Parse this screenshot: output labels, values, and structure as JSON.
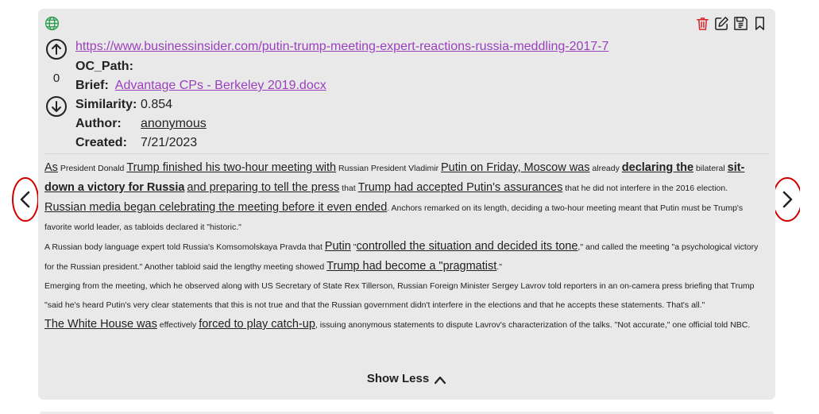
{
  "card": {
    "url": "https://www.businessinsider.com/putin-trump-meeting-expert-reactions-russia-meddling-2017-7",
    "vote_count": "0",
    "oc_path_label": "OC_Path:",
    "brief_label": "Brief:",
    "brief_link": "Advantage CPs - Berkeley 2019.docx",
    "similarity_label": "Similarity:",
    "similarity_value": "0.854",
    "author_label": "Author:",
    "author_value": "anonymous",
    "created_label": "Created:",
    "created_value": "7/21/2023",
    "show_less_label": "Show Less"
  },
  "icons": {
    "globe": "globe-icon",
    "delete": "trash-icon",
    "edit": "edit-icon",
    "save": "save-icon",
    "bookmark": "bookmark-icon",
    "upvote": "arrow-up-circle-icon",
    "downvote": "arrow-down-circle-icon",
    "prev": "chevron-left-icon",
    "next": "chevron-right-icon"
  },
  "colors": {
    "link": "#9b3fbf",
    "delete": "#d62828",
    "globe": "#2e9e4f",
    "nav_ring": "#d10000",
    "card_bg": "#e9e9e9"
  },
  "body": {
    "p1": [
      {
        "t": "As",
        "s": "hl"
      },
      {
        "t": " President Donald ",
        "s": "sm"
      },
      {
        "t": "Trump finished his two-hour meeting with",
        "s": "hl"
      },
      {
        "t": " Russian President Vladimir ",
        "s": "sm"
      },
      {
        "t": "Putin on Friday, Moscow was",
        "s": "hl"
      },
      {
        "t": " already ",
        "s": "sm"
      },
      {
        "t": "declaring the",
        "s": "hlb"
      },
      {
        "t": " bilateral ",
        "s": "sm"
      },
      {
        "t": "sit-down a victory for Russia",
        "s": "hlb"
      },
      {
        "t": " ",
        "s": "sm"
      },
      {
        "t": "and preparing to tell the press",
        "s": "hl"
      },
      {
        "t": " that ",
        "s": "sm"
      },
      {
        "t": "Trump had accepted Putin's assurances",
        "s": "hl"
      },
      {
        "t": " that he did not interfere in the 2016 election.",
        "s": "sm"
      }
    ],
    "p2": [
      {
        "t": "Russian media began celebrating the meeting before it even ended",
        "s": "hl"
      },
      {
        "t": ". Anchors remarked on its length, deciding a two-hour meeting meant that Putin must be Trump's favorite world leader, as tabloids declared it \"historic.\"",
        "s": "sm"
      }
    ],
    "p3": [
      {
        "t": "A Russian body language expert told Russia's Komsomolskaya Pravda that ",
        "s": "sm"
      },
      {
        "t": "Putin",
        "s": "hl"
      },
      {
        "t": " \"",
        "s": "sm"
      },
      {
        "t": "controlled the situation and decided its tone",
        "s": "hl"
      },
      {
        "t": ",\" and called the meeting \"a psychological victory for the Russian president.\" Another tabloid said the lengthy meeting showed ",
        "s": "sm"
      },
      {
        "t": "Trump had become a \"pragmatist",
        "s": "hl"
      },
      {
        "t": ".\"",
        "s": "sm"
      }
    ],
    "p4": [
      {
        "t": "Emerging from the meeting, which he observed along with US Secretary of State Rex Tillerson, Russian Foreign Minister Sergey Lavrov told reporters in an on-camera press briefing that Trump \"said he's heard Putin's very clear statements that this is not true and that the Russian government didn't interfere in the elections and that he accepts these statements. That's all.\"",
        "s": "sm"
      }
    ],
    "p5": [
      {
        "t": "The White House was",
        "s": "hl"
      },
      {
        "t": " effectively ",
        "s": "sm"
      },
      {
        "t": "forced to play catch-up",
        "s": "hl"
      },
      {
        "t": ", issuing anonymous statements to dispute Lavrov's characterization of the talks. \"Not accurate,\" one official told NBC.",
        "s": "sm"
      }
    ]
  }
}
